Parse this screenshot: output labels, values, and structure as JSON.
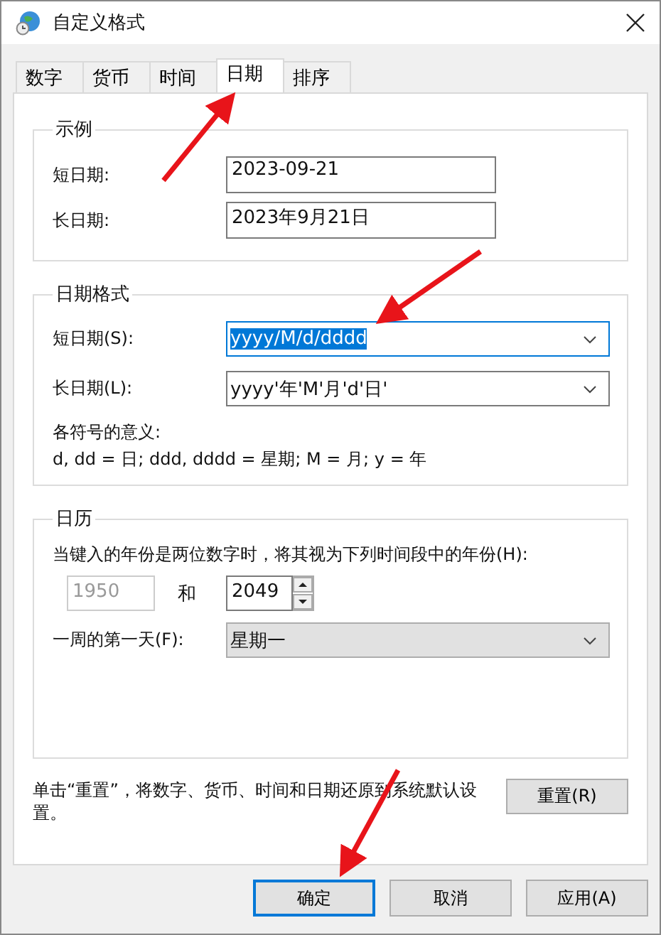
{
  "window": {
    "title": "自定义格式"
  },
  "tabs": [
    {
      "label": "数字",
      "selected": false
    },
    {
      "label": "货币",
      "selected": false
    },
    {
      "label": "时间",
      "selected": false
    },
    {
      "label": "日期",
      "selected": true
    },
    {
      "label": "排序",
      "selected": false
    }
  ],
  "example": {
    "title": "示例",
    "rows": [
      {
        "label": "短日期:",
        "value": "2023-09-21"
      },
      {
        "label": "长日期:",
        "value": "2023年9月21日"
      }
    ]
  },
  "date_formats": {
    "title": "日期格式",
    "rows": [
      {
        "label": "短日期(S):",
        "value": "yyyy/M/d/dddd",
        "focused": true
      },
      {
        "label": "长日期(L):",
        "value": "yyyy'年'M'月'd'日'",
        "focused": false
      }
    ],
    "legend_title": "各符号的意义:",
    "legend": "d, dd = 日;  ddd, dddd = 星期;  M = 月;  y = 年"
  },
  "calendar": {
    "title": "日历",
    "two_digit_label": "当键入的年份是两位数字时，将其视为下列时间段中的年份(H):",
    "start_year": "1950",
    "start_disabled": true,
    "and": "和",
    "end_year": "2049",
    "first_day_label": "一周的第一天(F):",
    "first_day": "星期一"
  },
  "reset": {
    "text": "单击“重置”，将数字、货币、时间和日期还原到系统默认设置。",
    "button": "重置(R)"
  },
  "buttons": [
    {
      "label": "确定",
      "default": true
    },
    {
      "label": "取消",
      "default": false
    },
    {
      "label": "应用(A)",
      "default": false
    }
  ]
}
